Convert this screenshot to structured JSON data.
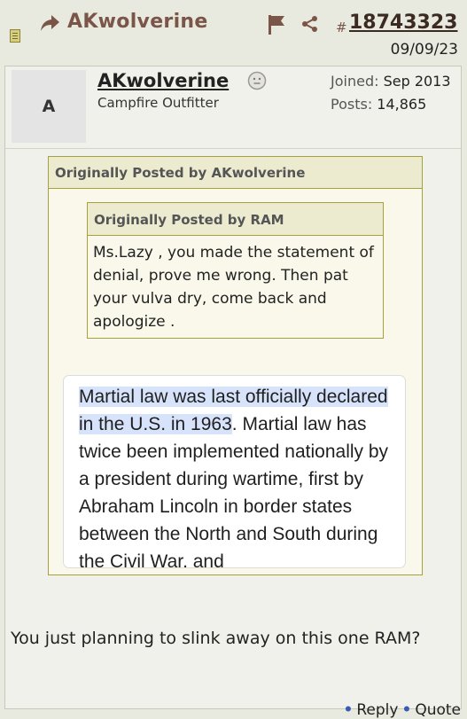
{
  "header": {
    "username": "AKwolverine",
    "hash": "#",
    "post_number": "18743323",
    "date": "09/09/23"
  },
  "user": {
    "avatar_letter": "A",
    "name": "AKwolverine",
    "title": "Campfire Outfitter",
    "joined_label": "Joined:",
    "joined_value": "Sep 2013",
    "posts_label": "Posts:",
    "posts_value": "14,865"
  },
  "outer_quote": {
    "header": "Originally Posted by AKwolverine"
  },
  "inner_quote": {
    "header": "Originally Posted by RAM",
    "body": "Ms.Lazy , you made the statement of denial, prove me wrong. Then pat your vulva dry, come back and apologize ."
  },
  "embed": {
    "highlight": "Martial law was last officially declared in the U.S. in 1963",
    "rest": ". Martial law has twice been implemented nationally by a president during wartime, first by Abraham Lincoln in border states between the North and South during the Civil War, and"
  },
  "reply": {
    "text": "You just planning to slink away on this one RAM?"
  },
  "footer": {
    "reply_label": "Reply",
    "quote_label": "Quote",
    "separator": "•"
  },
  "colors": {
    "header_text": "#7a5548",
    "quote_border": "#a7a13d",
    "quote_header_bg": "#ecebd0",
    "highlight": "#d7e3fb"
  },
  "icons": [
    "note-icon",
    "share-arrow-icon",
    "flag-icon",
    "share-icon",
    "offline-smiley-icon"
  ]
}
